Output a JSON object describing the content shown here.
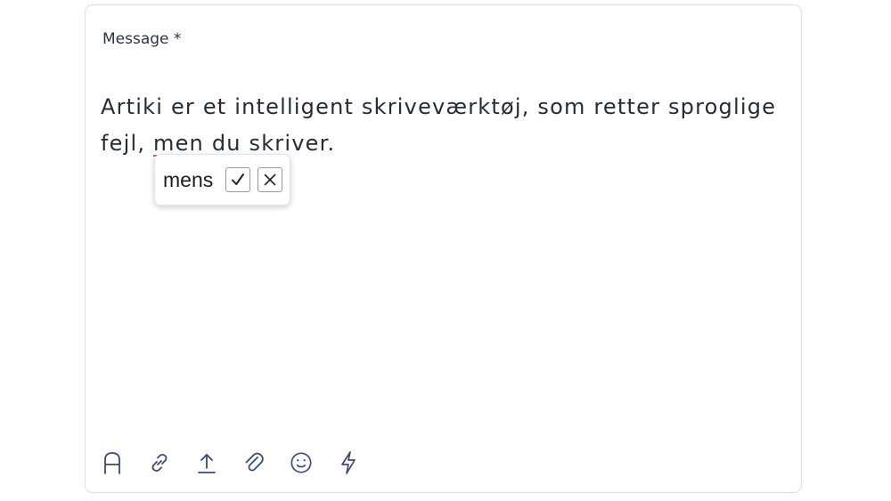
{
  "form": {
    "field_label": "Message *",
    "message": {
      "before": "Artiki er et intelligent skriveværktøj, som retter sproglige fejl, ",
      "flagged_word": "men",
      "after": " du skriver."
    }
  },
  "suggestion_popup": {
    "suggestion": "mens",
    "accept_icon": "checkmark-icon",
    "reject_icon": "close-icon"
  },
  "toolbar": {
    "icons": [
      "text-format-icon",
      "link-icon",
      "upload-icon",
      "attachment-icon",
      "emoji-icon",
      "lightning-icon"
    ]
  },
  "colors": {
    "icon": "#3a4a78",
    "text": "#262b36",
    "error_underline": "#e05b5b",
    "border": "#dcdee3"
  }
}
